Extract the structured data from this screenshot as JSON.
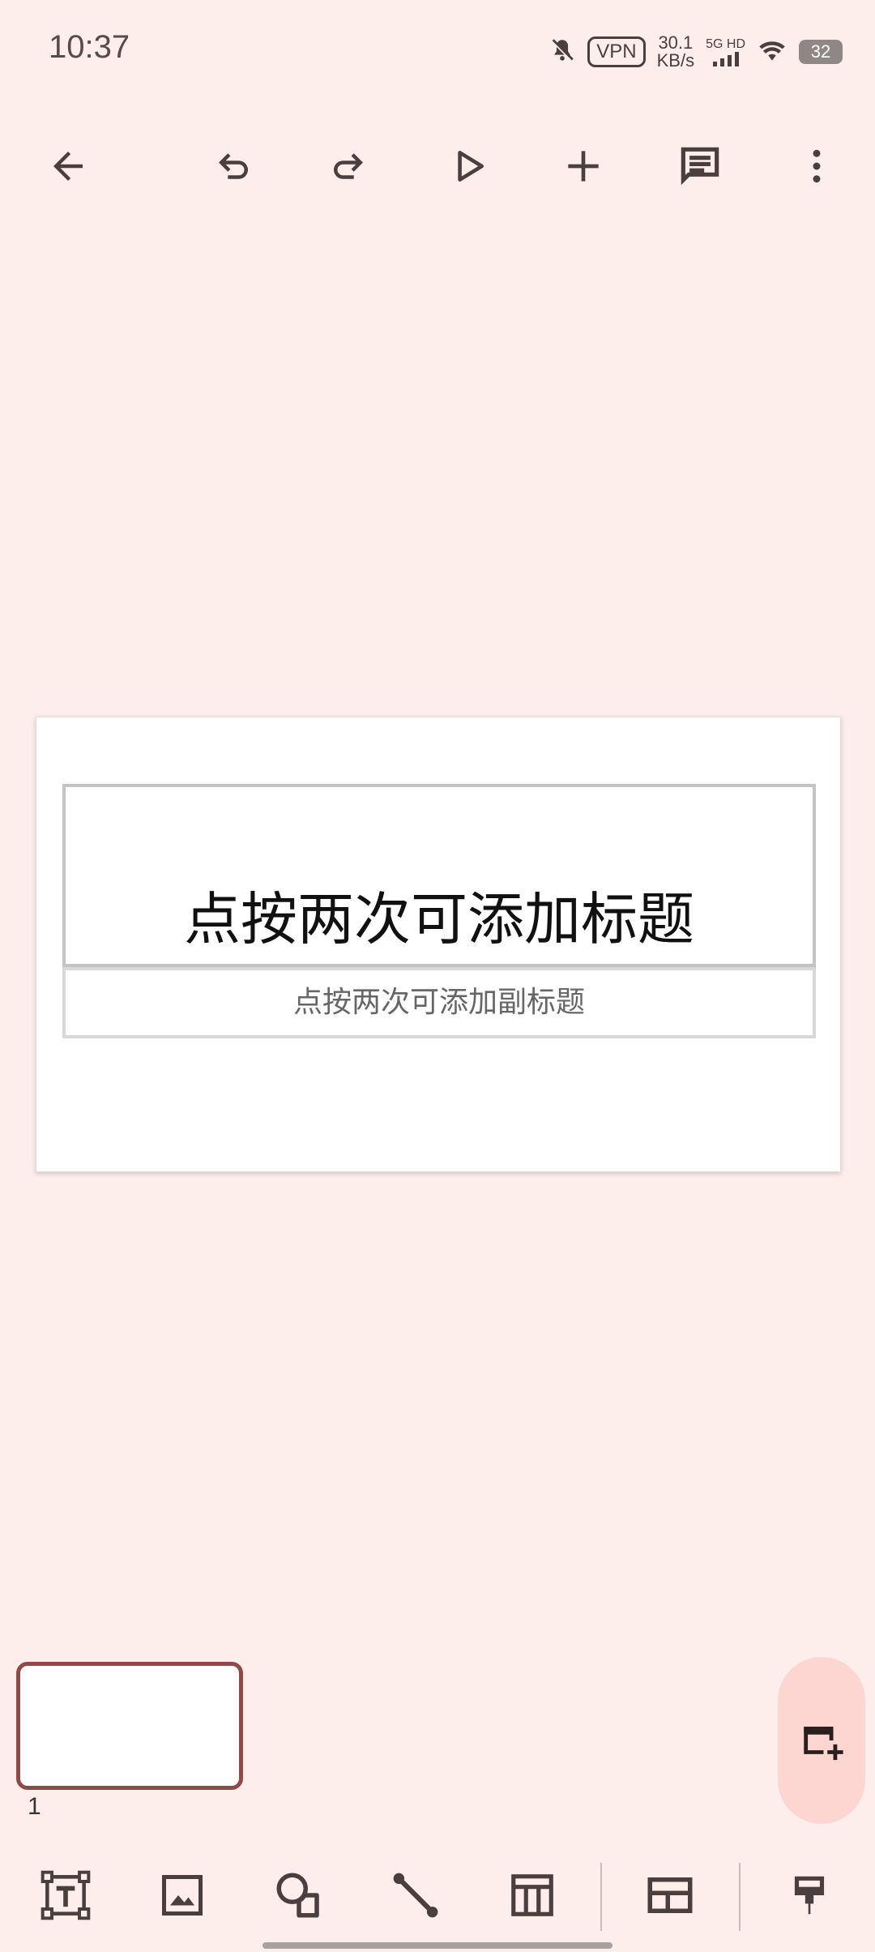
{
  "status_bar": {
    "time": "10:37",
    "vpn": "VPN",
    "speed_value": "30.1",
    "speed_unit": "KB/s",
    "network": "5G HD",
    "battery": "32"
  },
  "toolbar": {
    "icons": [
      "back-arrow-icon",
      "undo-icon",
      "redo-icon",
      "play-icon",
      "add-icon",
      "comment-icon",
      "more-vert-icon"
    ]
  },
  "slide": {
    "title_placeholder": "点按两次可添加标题",
    "subtitle_placeholder": "点按两次可添加副标题"
  },
  "thumbnails": [
    {
      "number": "1"
    }
  ],
  "bottom_toolbar": {
    "icons": [
      "text-box-icon",
      "image-icon",
      "shapes-icon",
      "line-icon",
      "table-icon",
      "layout-icon",
      "format-paint-icon"
    ]
  },
  "colors": {
    "background": "#fdeeec",
    "accent": "#8d4a46",
    "fab": "#fdd6d2",
    "icon": "#4a3f3e"
  }
}
